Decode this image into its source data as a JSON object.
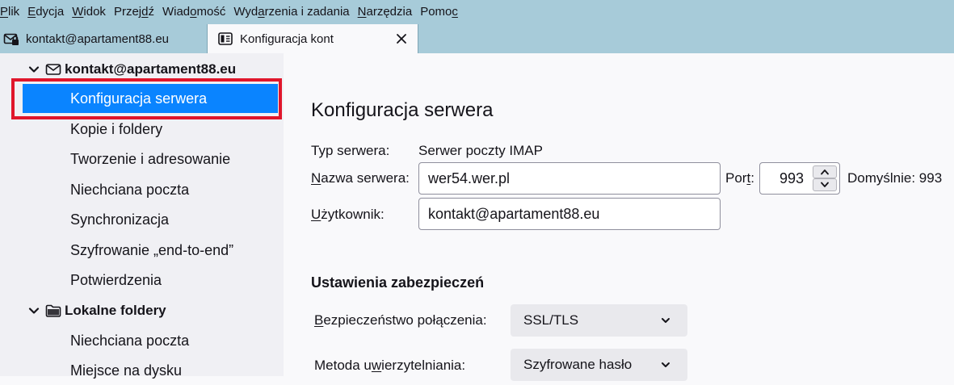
{
  "menubar": {
    "items": [
      {
        "label": "Plik",
        "access": "P"
      },
      {
        "label": "Edycja",
        "access": "E"
      },
      {
        "label": "Widok",
        "access": "W"
      },
      {
        "label": "Przejdź",
        "access": "d"
      },
      {
        "label": "Wiadomość",
        "access": "o"
      },
      {
        "label": "Wydarzenia i zadania",
        "access": "a"
      },
      {
        "label": "Narzędzia",
        "access": "N"
      },
      {
        "label": "Pomoc",
        "access": "c"
      }
    ]
  },
  "tabs": [
    {
      "title": "kontakt@apartament88.eu",
      "icon": "mail-lock-icon",
      "active": false
    },
    {
      "title": "Konfiguracja kont",
      "icon": "account-settings-icon",
      "active": true,
      "close_icon": "close-icon"
    }
  ],
  "sidebar": {
    "account": {
      "label": "kontakt@apartament88.eu",
      "icon": "envelope-icon",
      "expanded": true
    },
    "account_items": [
      {
        "label": "Konfiguracja serwera",
        "selected": true
      },
      {
        "label": "Kopie i foldery"
      },
      {
        "label": "Tworzenie i adresowanie"
      },
      {
        "label": "Niechciana poczta"
      },
      {
        "label": "Synchronizacja"
      },
      {
        "label": "Szyfrowanie „end-to-end”"
      },
      {
        "label": "Potwierdzenia"
      }
    ],
    "local": {
      "label": "Lokalne foldery",
      "icon": "folder-icon",
      "expanded": true
    },
    "local_items": [
      {
        "label": "Niechciana poczta"
      },
      {
        "label": "Miejsce na dysku"
      }
    ]
  },
  "main": {
    "title": "Konfiguracja serwera",
    "server_type_label": "Typ serwera:",
    "server_type_value": "Serwer poczty IMAP",
    "server_name_label": "Nazwa serwera:",
    "server_name_access": "N",
    "server_name_value": "wer54.wer.pl",
    "port_label": "Port:",
    "port_access": "t",
    "port_value": "993",
    "port_default": "Domyślnie: 993",
    "user_label": "Użytkownik:",
    "user_access": "U",
    "user_value": "kontakt@apartament88.eu",
    "security_title": "Ustawienia zabezpieczeń",
    "connection_security_label": "Bezpieczeństwo połączenia:",
    "connection_security_access": "B",
    "connection_security_value": "SSL/TLS",
    "auth_method_label": "Metoda uwierzytelniania:",
    "auth_method_access": "w",
    "auth_method_value": "Szyfrowane hasło"
  },
  "colors": {
    "menubar_bg": "#a7cbd9",
    "selection": "#0a84ff",
    "highlight_box": "#e0162b",
    "sidebar_bg": "#f0f0f4",
    "content_bg": "#f9f9fb"
  }
}
